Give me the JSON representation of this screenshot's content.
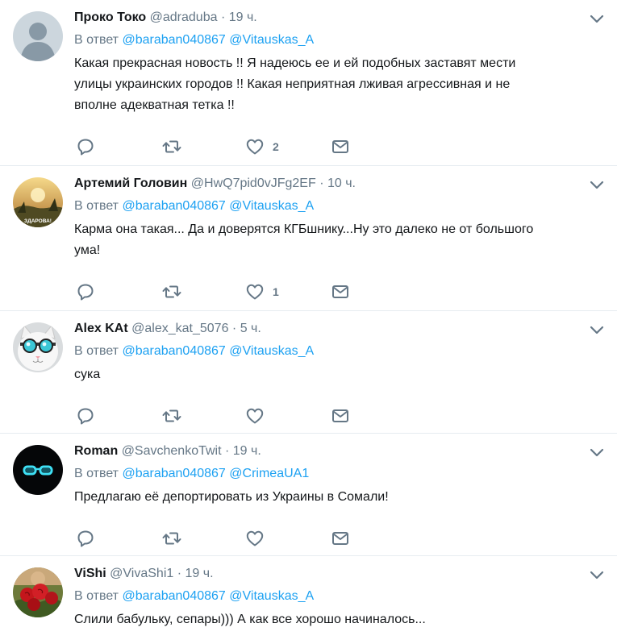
{
  "tweets": [
    {
      "name": "Проко Токо",
      "handle": "@adraduba",
      "time": "19 ч.",
      "reply_prefix": "В ответ",
      "reply_to": [
        "@baraban040867",
        "@Vitauskas_A"
      ],
      "text_lines": [
        "Какая прекрасная новость !! Я надеюсь ее и ей подобных заставят мести",
        "улицы украинских городов !! Какая неприятная лживая агрессивная и не",
        "вполне адекватная тетка !!"
      ],
      "like_count": "2",
      "avatar": "default-avatar-icon"
    },
    {
      "name": "Артемий Головин",
      "handle": "@HwQ7pid0vJFg2EF",
      "time": "10 ч.",
      "reply_prefix": "В ответ",
      "reply_to": [
        "@baraban040867",
        "@Vitauskas_A"
      ],
      "text_lines": [
        "Карма она такая... Да и доверятся КГБшнику...Ну это далеко не от большого",
        "ума!"
      ],
      "like_count": "1",
      "avatar": "landscape-avatar",
      "avatar_caption": "ЗДАРОВА!"
    },
    {
      "name": "Alex KAt",
      "handle": "@alex_kat_5076",
      "time": "5 ч.",
      "reply_prefix": "В ответ",
      "reply_to": [
        "@baraban040867",
        "@Vitauskas_A"
      ],
      "text_lines": [
        "сука"
      ],
      "like_count": "",
      "avatar": "cat-with-goggles-avatar"
    },
    {
      "name": "Roman",
      "handle": "@SavchenkoTwit",
      "time": "19 ч.",
      "reply_prefix": "В ответ",
      "reply_to": [
        "@baraban040867",
        "@CrimeaUA1"
      ],
      "text_lines": [
        "Предлагаю её депортировать из Украины в Сомали!"
      ],
      "like_count": "",
      "avatar": "neon-glasses-avatar"
    },
    {
      "name": "ViShi",
      "handle": "@VivaShi1",
      "time": "19 ч.",
      "reply_prefix": "В ответ",
      "reply_to": [
        "@baraban040867",
        "@Vitauskas_A"
      ],
      "text_lines": [
        "Слили бабульку, сепары))) А как все хорошо начиналось..."
      ],
      "like_count": "",
      "avatar": "roses-avatar"
    }
  ],
  "dot": "·",
  "colors": {
    "link": "#1da1f2",
    "muted": "#657786",
    "text": "#14171a",
    "divider": "#e6ecf0"
  }
}
